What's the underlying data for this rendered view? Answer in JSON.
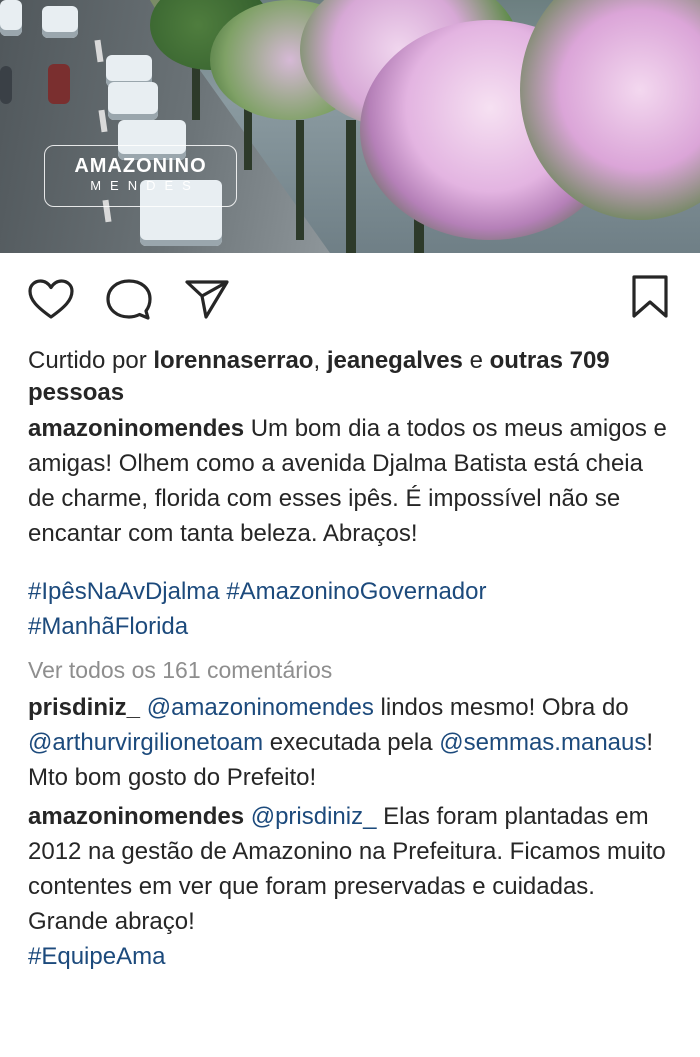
{
  "photo": {
    "logo_line1": "AMAZONINO",
    "logo_line2": "MENDES"
  },
  "actions": {
    "like_icon": "heart-outline-icon",
    "comment_icon": "comment-bubble-icon",
    "share_icon": "paper-plane-icon",
    "save_icon": "bookmark-icon"
  },
  "likes": {
    "prefix": "Curtido por ",
    "user1": "lorennaserrao",
    "sep": ", ",
    "user2": "jeanegalves",
    "conj": " e ",
    "others": "outras 709 pessoas"
  },
  "caption": {
    "username": "amazoninomendes",
    "text": " Um bom dia a todos os meus amigos e amigas! Olhem como a avenida Djalma Batista está cheia de charme, florida com esses ipês. É impossível não se encantar com tanta beleza. Abraços!"
  },
  "hashtags": {
    "tag1": "#IpêsNaAvDjalma",
    "tag2": "#AmazoninoGovernador",
    "tag3": "#ManhãFlorida"
  },
  "view_all_comments": "Ver todos os 161 comentários",
  "comments": [
    {
      "username": "prisdiniz_",
      "mention1": "@amazoninomendes",
      "text1": " lindos mesmo! Obra do ",
      "mention2": "@arthurvirgilionetoam",
      "text2": " executada pela ",
      "mention3": "@semmas.manaus",
      "text3": "! Mto bom gosto do Prefeito!"
    },
    {
      "username": "amazoninomendes",
      "mention1": "@prisdiniz_",
      "text1": " Elas foram plantadas em 2012 na gestão de Amazonino na Prefeitura. Ficamos muito contentes em ver que foram preservadas e cuidadas. Grande abraço!",
      "hashtag": "#EquipeAma"
    }
  ],
  "colors": {
    "link": "#1c4a7c",
    "muted": "#8e8e8e",
    "text": "#262626"
  }
}
